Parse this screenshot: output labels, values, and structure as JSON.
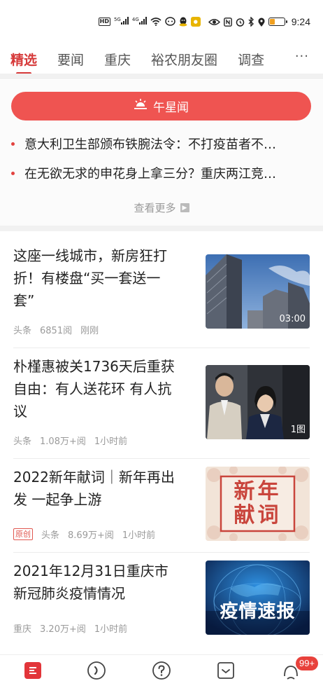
{
  "status_bar": {
    "time": "9:24",
    "hd_label": "HD",
    "signal_labels": [
      "5G",
      "4G"
    ],
    "battery_level": 0.35,
    "icons": [
      "hd-icon",
      "signal-5g-icon",
      "signal-4g-icon",
      "wifi-icon",
      "chat-icon",
      "qq-icon",
      "app-badge-icon",
      "eye-icon",
      "nfc-icon",
      "alarm-icon",
      "bluetooth-icon",
      "location-icon",
      "battery-icon"
    ]
  },
  "tabs": {
    "items": [
      {
        "label": "精选",
        "active": true
      },
      {
        "label": "要闻",
        "active": false
      },
      {
        "label": "重庆",
        "active": false
      },
      {
        "label": "裕农朋友圈",
        "active": false
      },
      {
        "label": "调查",
        "active": false
      }
    ],
    "more_label": "···"
  },
  "noon_news": {
    "button_label": "午星闻",
    "headlines": [
      "意大利卫生部颁布铁腕法令：不打疫苗者不…",
      "在无欲无求的申花身上拿三分？重庆两江竞…"
    ],
    "see_more_label": "查看更多"
  },
  "articles": [
    {
      "title_lines": [
        "这座一线城市，新房狂打",
        "折！有楼盘“买一套送一",
        "套”"
      ],
      "source": "头条",
      "reads": "6851阅",
      "time": "刚刚",
      "original": false,
      "thumb_label": "03:00",
      "thumb_kind": "buildings"
    },
    {
      "title_lines": [
        "朴槿惠被关1736天后重获",
        "自由：有人送花环 有人抗",
        "议"
      ],
      "source": "头条",
      "reads": "1.08万+阅",
      "time": "1小时前",
      "original": false,
      "thumb_label": "1图",
      "thumb_kind": "people"
    },
    {
      "title_lines": [
        "2022新年献词｜新年再出",
        "发 一起争上游"
      ],
      "source": "头条",
      "reads": "8.69万+阅",
      "time": "1小时前",
      "original": true,
      "original_label": "原创",
      "thumb_text": [
        "新年",
        "献词"
      ],
      "thumb_kind": "newyear"
    },
    {
      "title_lines": [
        "2021年12月31日重庆市",
        "新冠肺炎疫情情况"
      ],
      "source": "重庆",
      "reads": "3.20万+阅",
      "time": "1小时前",
      "original": false,
      "thumb_text": [
        "疫情速报"
      ],
      "thumb_kind": "globe"
    }
  ],
  "bottom_nav": {
    "items": [
      "home-icon",
      "discover-icon",
      "question-icon",
      "inbox-icon",
      "profile-icon"
    ],
    "badge": "99+"
  },
  "colors": {
    "accent": "#d63a3a",
    "noon_button": "#ef5451",
    "meta_text": "#9a9a9a"
  }
}
